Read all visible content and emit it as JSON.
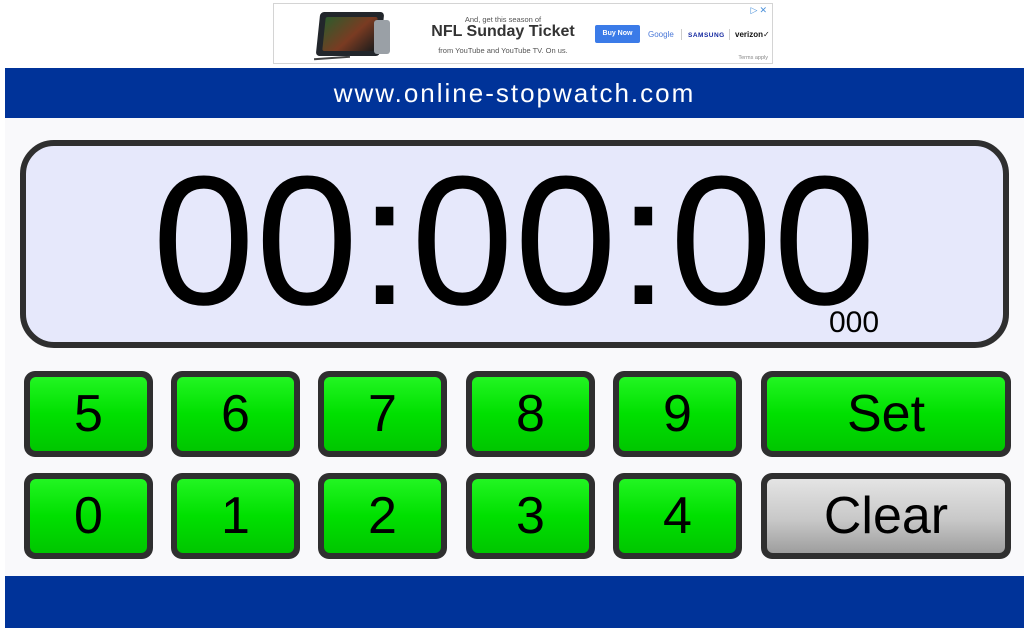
{
  "ad": {
    "pre_title": "And, get this season of",
    "title": "NFL Sunday Ticket",
    "subtitle": "from YouTube and YouTube TV. On us.",
    "cta": "Buy Now",
    "brands": [
      "Google",
      "SAMSUNG",
      "verizon✓"
    ],
    "terms": "Terms apply",
    "icons": "▷✕"
  },
  "header": {
    "title": "www.online-stopwatch.com"
  },
  "display": {
    "time": "00:00:00",
    "milliseconds": "000"
  },
  "keypad": {
    "row1": [
      "5",
      "6",
      "7",
      "8",
      "9",
      "Set"
    ],
    "row2": [
      "0",
      "1",
      "2",
      "3",
      "4",
      "Clear"
    ]
  },
  "colors": {
    "brand_blue": "#003399",
    "key_green": "#00e000",
    "display_bg": "#e6e8fb",
    "clear_gray": "#c8c8c8"
  }
}
